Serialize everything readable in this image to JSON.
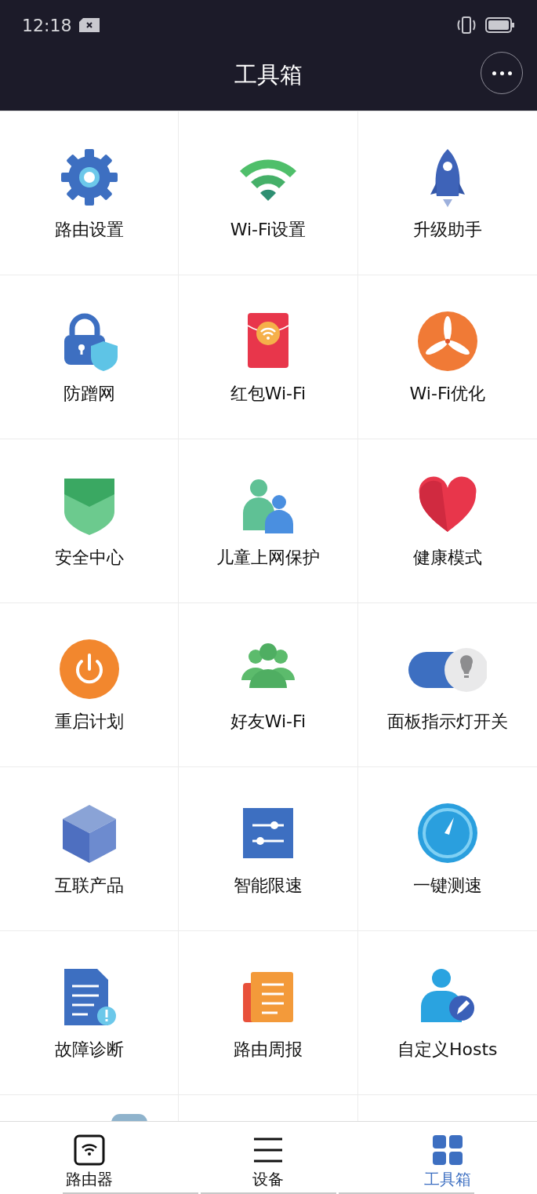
{
  "status_bar": {
    "time": "12:18"
  },
  "header": {
    "title": "工具箱"
  },
  "tools": [
    {
      "label": "路由设置"
    },
    {
      "label": "Wi-Fi设置"
    },
    {
      "label": "升级助手"
    },
    {
      "label": "防蹭网"
    },
    {
      "label": "红包Wi-Fi"
    },
    {
      "label": "Wi-Fi优化"
    },
    {
      "label": "安全中心"
    },
    {
      "label": "儿童上网保护"
    },
    {
      "label": "健康模式"
    },
    {
      "label": "重启计划"
    },
    {
      "label": "好友Wi-Fi"
    },
    {
      "label": "面板指示灯开关"
    },
    {
      "label": "互联产品"
    },
    {
      "label": "智能限速"
    },
    {
      "label": "一键测速"
    },
    {
      "label": "故障诊断"
    },
    {
      "label": "路由周报"
    },
    {
      "label": "自定义Hosts"
    }
  ],
  "bottom_nav": [
    {
      "label": "路由器",
      "selected": false
    },
    {
      "label": "设备",
      "selected": false
    },
    {
      "label": "工具箱",
      "selected": true
    }
  ]
}
